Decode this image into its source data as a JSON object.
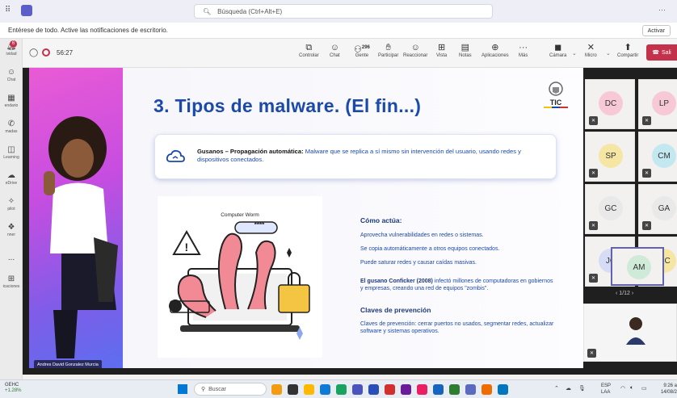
{
  "titlebar": {
    "search_placeholder": "Búsqueda (Ctrl+Alt+E)",
    "more": "···"
  },
  "notification": {
    "text": "Entérese de todo. Active las notificaciones de escritorio.",
    "button": "Activar"
  },
  "rail": {
    "items": [
      {
        "label": "ividad",
        "icon": "bell-icon",
        "badge": "6"
      },
      {
        "label": "Chat",
        "icon": "chat-icon"
      },
      {
        "label": "endario",
        "icon": "calendar-icon"
      },
      {
        "label": "madas",
        "icon": "phone-icon"
      },
      {
        "label": "Learning",
        "icon": "learning-icon"
      },
      {
        "label": "eDrive",
        "icon": "cloud-icon"
      },
      {
        "label": "pilot",
        "icon": "copilot-icon"
      },
      {
        "label": "nner",
        "icon": "planner-icon"
      },
      {
        "label": "...",
        "icon": "more-icon"
      },
      {
        "label": "icaciones",
        "icon": "apps-icon"
      }
    ]
  },
  "meeting": {
    "timer": "56:27",
    "toolbar": [
      {
        "label": "Controlar",
        "icon": "share-control-icon"
      },
      {
        "label": "Chat",
        "icon": "chat-icon"
      },
      {
        "label": "Gente",
        "icon": "people-icon",
        "count": "296"
      },
      {
        "label": "Participar",
        "icon": "raise-hand-icon"
      },
      {
        "label": "Reaccionar",
        "icon": "emoji-icon"
      },
      {
        "label": "Vista",
        "icon": "grid-view-icon"
      },
      {
        "label": "Notas",
        "icon": "notes-icon"
      },
      {
        "label": "Aplicaciones",
        "icon": "plus-apps-icon"
      },
      {
        "label": "Más",
        "icon": "more-icon"
      },
      {
        "label": "Cámara",
        "icon": "camera-off-icon"
      },
      {
        "label": "Micro",
        "icon": "mic-off-icon"
      },
      {
        "label": "Compartir",
        "icon": "share-icon"
      }
    ],
    "leave_label": "Sali"
  },
  "slide": {
    "title": "3. Tipos de malware. (El fin...)",
    "logo_text": "TIC",
    "gusanos_heading": "Gusanos – Propagación automática:",
    "gusanos_body": " Malware que se replica a sí mismo sin intervención del usuario, usando redes y dispositivos conectados.",
    "image_title": "Computer Worm",
    "image_password": "****",
    "como_actua": "Cómo actúa:",
    "bullets": [
      "Aprovecha vulnerabilidades en redes o sistemas.",
      "Se copia automáticamente a otros equipos conectados.",
      "Puede saturar redes y causar caídas masivas."
    ],
    "conficker_bold": "El gusano Conficker (2008)",
    "conficker_rest": " infectó millones de computadoras en gobiernos y empresas, creando una red de equipos \"zombis\".",
    "claves_heading": "Claves de prevención",
    "claves_body": "Claves de prevención: cerrar puertos no usados, segmentar redes, actualizar software y sistemas operativos."
  },
  "presenter_name": "Andres David Gonzalez Murcia",
  "participants": [
    {
      "initials": "DC",
      "color": "#f7c9d6"
    },
    {
      "initials": "LP",
      "color": "#f7c9d6"
    },
    {
      "initials": "SP",
      "color": "#f5e6a3"
    },
    {
      "initials": "CM",
      "color": "#c4e8ef"
    },
    {
      "initials": "GC",
      "color": "#e9e9e9"
    },
    {
      "initials": "GA",
      "color": "#e9e9e9"
    },
    {
      "initials": "JC",
      "color": "#d7dcf6"
    },
    {
      "initials": "MC",
      "color": "#f5e6a3"
    },
    {
      "initials": "AM",
      "color": "#cfead9"
    }
  ],
  "pagination": "1/12",
  "taskbar": {
    "weather_title": "GEHC",
    "weather_value": "+1.28%",
    "search": "Buscar",
    "lang_top": "ESP",
    "lang_bottom": "LAA",
    "time": "9:26 a",
    "date": "14/08/2"
  }
}
